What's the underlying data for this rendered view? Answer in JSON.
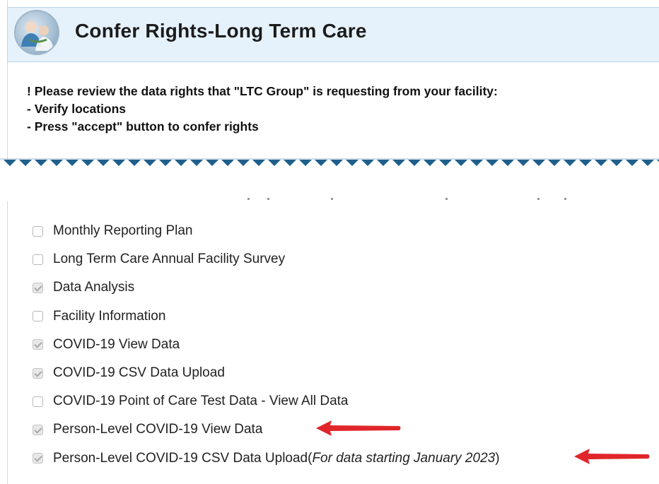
{
  "header": {
    "title": "Confer Rights-Long Term Care",
    "logo_icon": "healthcare-people-logo"
  },
  "notice": {
    "line1": "! Please review the data rights that \"LTC Group\" is requesting from your facility:",
    "line2": " - Verify locations",
    "line3": " - Press \"accept\" button to confer rights"
  },
  "permissions": [
    {
      "label": "Monthly Reporting Plan",
      "checked": false
    },
    {
      "label": "Long Term Care Annual Facility Survey",
      "checked": false
    },
    {
      "label": "Data Analysis",
      "checked": true
    },
    {
      "label": "Facility Information",
      "checked": false
    },
    {
      "label": "COVID-19 View Data",
      "checked": true
    },
    {
      "label": "COVID-19 CSV Data Upload",
      "checked": true
    },
    {
      "label": "COVID-19 Point of Care Test Data - View All Data",
      "checked": false
    },
    {
      "label": "Person-Level COVID-19 View Data",
      "checked": true
    },
    {
      "label": "Person-Level COVID-19 CSV Data Upload",
      "checked": true,
      "note_open": "(",
      "note": "For data starting January 2023",
      "note_close": ")"
    }
  ],
  "colors": {
    "header_bg": "#e6f2fb",
    "zigzag": "#1f5f8b",
    "annotation_arrow": "#e0262a"
  }
}
